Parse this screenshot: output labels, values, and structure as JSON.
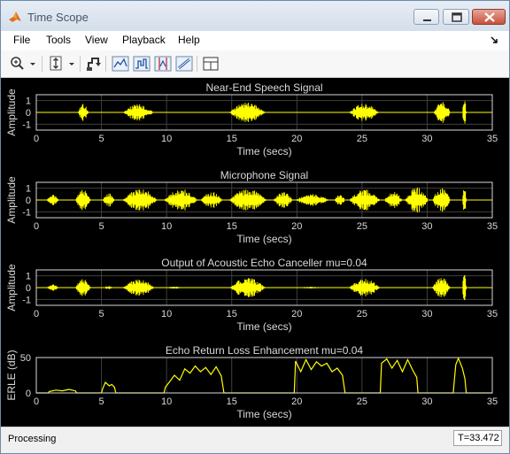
{
  "window": {
    "title": "Time Scope"
  },
  "menu": {
    "items": [
      "File",
      "Tools",
      "View",
      "Playback",
      "Help"
    ]
  },
  "toolbar": {
    "buttons": [
      "zoom-in-icon",
      "zoom-dropdown-icon",
      "scale-axes-icon",
      "highlight-simulink-icon",
      "triggers-icon",
      "signal-statistics-icon",
      "cursor-measurements-icon",
      "bilevel-measurements-icon",
      "layout-icon"
    ]
  },
  "status": {
    "text": "Processing",
    "time": "T=33.472"
  },
  "colors": {
    "background": "#000000",
    "trace": "#ffff00",
    "grid": "#404040",
    "text": "#d9d9d9"
  },
  "chart_data": [
    {
      "type": "line",
      "title": "Near-End Speech Signal",
      "xlabel": "Time (secs)",
      "ylabel": "Amplitude",
      "xlim": [
        0,
        35
      ],
      "ylim": [
        -1.5,
        1.5
      ],
      "xticks": [
        0,
        5,
        10,
        15,
        20,
        25,
        30,
        35
      ],
      "yticks": [
        1,
        0,
        -1
      ],
      "kind": "signal",
      "bursts": [
        [
          3.2,
          4.0,
          0.75
        ],
        [
          6.6,
          9.0,
          0.7
        ],
        [
          14.8,
          17.6,
          0.85
        ],
        [
          24.0,
          26.3,
          0.75
        ],
        [
          30.5,
          31.8,
          0.9
        ],
        [
          32.7,
          33.0,
          1.3
        ]
      ]
    },
    {
      "type": "line",
      "title": "Microphone Signal",
      "xlabel": "Time (secs)",
      "ylabel": "Amplitude",
      "xlim": [
        0,
        35
      ],
      "ylim": [
        -1.5,
        1.5
      ],
      "xticks": [
        0,
        5,
        10,
        15,
        20,
        25,
        30,
        35
      ],
      "yticks": [
        1,
        0,
        -1
      ],
      "kind": "signal",
      "bursts": [
        [
          0.8,
          1.7,
          0.5
        ],
        [
          3.0,
          4.2,
          0.9
        ],
        [
          5.1,
          6.0,
          0.6
        ],
        [
          6.6,
          9.3,
          1.0
        ],
        [
          9.8,
          12.4,
          0.95
        ],
        [
          12.6,
          14.3,
          0.7
        ],
        [
          14.8,
          17.7,
          0.95
        ],
        [
          18.2,
          19.7,
          0.7
        ],
        [
          19.9,
          22.5,
          0.5
        ],
        [
          22.9,
          23.7,
          0.5
        ],
        [
          24.0,
          26.4,
          0.9
        ],
        [
          26.7,
          28.1,
          0.7
        ],
        [
          28.3,
          30.1,
          1.1
        ],
        [
          30.4,
          31.8,
          1.1
        ],
        [
          32.7,
          33.0,
          1.3
        ]
      ]
    },
    {
      "type": "line",
      "title": "Output of Acoustic Echo Canceller mu=0.04",
      "xlabel": "Time (secs)",
      "ylabel": "Amplitude",
      "xlim": [
        0,
        35
      ],
      "ylim": [
        -1.5,
        1.5
      ],
      "xticks": [
        0,
        5,
        10,
        15,
        20,
        25,
        30,
        35
      ],
      "yticks": [
        1,
        0,
        -1
      ],
      "kind": "signal",
      "bursts": [
        [
          0.8,
          1.7,
          0.3
        ],
        [
          3.0,
          4.2,
          0.75
        ],
        [
          5.2,
          5.9,
          0.15
        ],
        [
          6.6,
          9.1,
          0.75
        ],
        [
          10.0,
          11.2,
          0.1
        ],
        [
          14.8,
          17.6,
          0.85
        ],
        [
          20.1,
          22.0,
          0.08
        ],
        [
          24.0,
          26.4,
          0.75
        ],
        [
          30.4,
          31.8,
          0.9
        ],
        [
          32.7,
          33.0,
          1.3
        ]
      ]
    },
    {
      "type": "line",
      "title": "Echo Return Loss Enhancement mu=0.04",
      "xlabel": "Time (secs)",
      "ylabel": "ERLE (dB)",
      "xlim": [
        0,
        35
      ],
      "ylim": [
        0,
        50
      ],
      "xticks": [
        0,
        5,
        10,
        15,
        20,
        25,
        30,
        35
      ],
      "yticks": [
        50,
        0
      ],
      "kind": "erle",
      "x": [
        0.0,
        0.9,
        1.0,
        1.5,
        2.0,
        2.5,
        3.0,
        3.1,
        5.0,
        5.1,
        5.3,
        5.6,
        5.8,
        6.0,
        6.1,
        9.8,
        9.9,
        10.2,
        10.6,
        11.0,
        11.4,
        11.8,
        12.2,
        12.6,
        13.0,
        13.4,
        13.8,
        14.2,
        14.4,
        19.8,
        19.9,
        20.3,
        20.7,
        21.1,
        21.5,
        21.9,
        22.3,
        22.7,
        23.1,
        23.5,
        23.7,
        26.4,
        26.5,
        26.9,
        27.3,
        27.7,
        28.1,
        28.5,
        28.9,
        29.2,
        29.3,
        32.0,
        32.1,
        32.2,
        32.4,
        32.7,
        32.9,
        33.0,
        35.0
      ],
      "y": [
        0,
        0,
        2,
        4,
        3,
        5,
        3,
        0,
        0,
        6,
        15,
        10,
        12,
        8,
        0,
        0,
        8,
        15,
        25,
        18,
        34,
        28,
        38,
        30,
        36,
        26,
        37,
        24,
        0,
        0,
        45,
        30,
        47,
        33,
        44,
        38,
        42,
        30,
        35,
        25,
        0,
        0,
        42,
        48,
        35,
        46,
        30,
        47,
        32,
        22,
        0,
        0,
        20,
        40,
        49,
        35,
        20,
        0,
        0
      ]
    }
  ]
}
